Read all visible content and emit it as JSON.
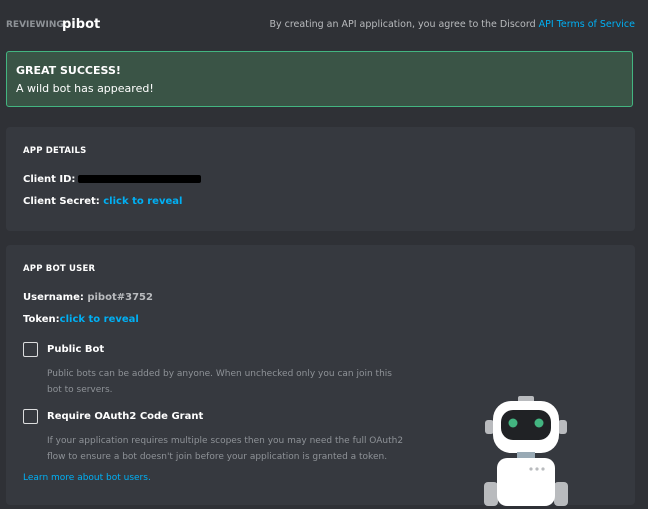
{
  "header": {
    "reviewing_prefix": "REVIEWING:",
    "app_name": "pibot",
    "terms_text": "By creating an API application, you agree to the Discord",
    "terms_link": "API Terms of Service"
  },
  "banner": {
    "title": "GREAT SUCCESS!",
    "message": "A wild bot has appeared!",
    "color": "#43b581"
  },
  "app_details": {
    "section_title": "APP DETAILS",
    "client_id_label": "Client ID:",
    "client_secret_label": "Client Secret:",
    "client_secret_link": "click to reveal"
  },
  "app_bot_user": {
    "section_title": "APP BOT USER",
    "username_label": "Username:",
    "username_value": "pibot#3752",
    "token_label": "Token:",
    "token_link": "click to reveal",
    "public_bot": {
      "label": "Public Bot",
      "checked": false,
      "description_line1": "Public bots can be added by anyone. When unchecked only you can join this",
      "description_line2": "bot to servers."
    },
    "require_oauth2": {
      "label": "Require OAuth2 Code Grant",
      "checked": false,
      "description_line1": "If your application requires multiple scopes then you may need the full OAuth2",
      "description_line2": "flow to ensure a bot doesn't join before your application is granted a token."
    },
    "learn_more_link": "Learn more about bot users."
  },
  "colors": {
    "background": "#2f3136",
    "card": "#36393f",
    "link": "#00b0f4"
  }
}
